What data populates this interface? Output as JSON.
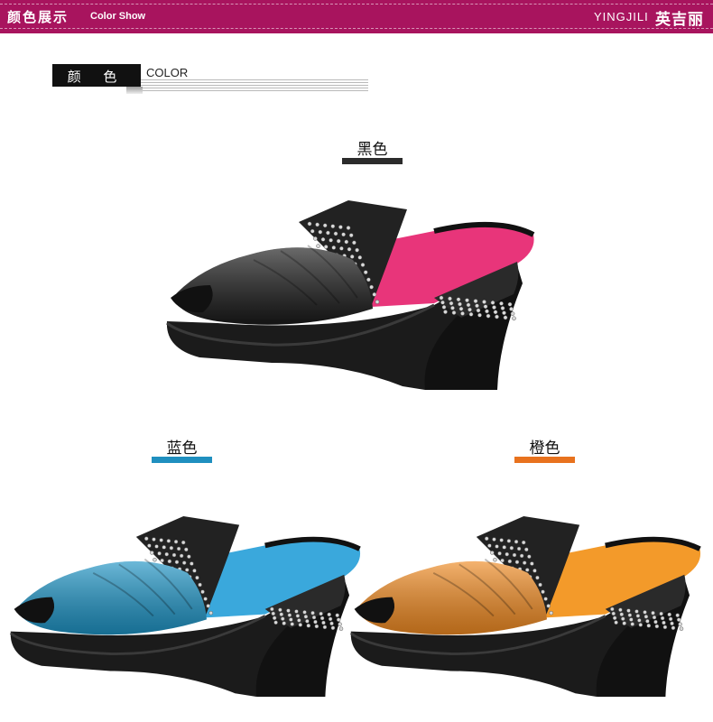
{
  "header": {
    "title_cn": "颜色展示",
    "title_en": "Color Show",
    "brand_en": "YINGJILI",
    "brand_cn": "英吉丽"
  },
  "section": {
    "label_cn": "颜 色",
    "label_en": "COLOR"
  },
  "colors": [
    {
      "name": "黑色",
      "swatch": "#2b2b2b",
      "upper": "#1a1a1a",
      "insole": "#e8357a"
    },
    {
      "name": "蓝色",
      "swatch": "#1f8fbf",
      "upper": "#1e93c4",
      "insole": "#3aa8dc"
    },
    {
      "name": "橙色",
      "swatch": "#e8721e",
      "upper": "#ef8a22",
      "insole": "#f39a2a"
    }
  ]
}
